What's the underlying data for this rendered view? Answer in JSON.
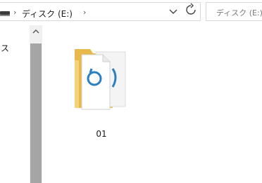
{
  "address_bar": {
    "crumbs": [
      "ディスク (E:)"
    ],
    "separator": "›"
  },
  "search": {
    "placeholder": "ディスク (E:)の"
  },
  "nav": {
    "visible_item_fragment": "ス"
  },
  "files": [
    {
      "name": "01",
      "type": "folder"
    }
  ],
  "colors": {
    "folder_back": "#e8b94a",
    "folder_front": "#f5d27a",
    "doc_paper": "#ffffff",
    "doc_glyph": "#2a7fc1",
    "scroll_thumb": "#a5a5a5",
    "scroll_track": "#f0f0f0"
  },
  "icons": [
    "drive-icon",
    "chevron-right-icon",
    "chevron-down-icon",
    "refresh-icon",
    "scroll-up-arrow-icon",
    "folder-icon"
  ]
}
